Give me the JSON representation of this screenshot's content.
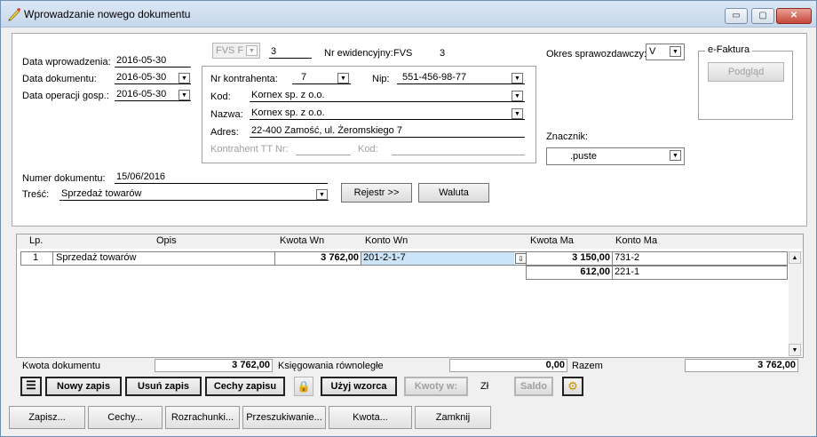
{
  "window": {
    "title": "Wprowadzanie nowego dokumentu",
    "min": "▭",
    "max": "▢",
    "close": "✕"
  },
  "dates": {
    "entry_label": "Data wprowadzenia:",
    "entry_value": "2016-05-30",
    "doc_label": "Data dokumentu:",
    "doc_value": "2016-05-30",
    "op_label": "Data operacji gosp.:",
    "op_value": "2016-05-30"
  },
  "docmeta": {
    "series": "FVS",
    "series_suffix": "F",
    "number": "3",
    "reg_label": "Nr ewidencyjny:",
    "reg_series": "FVS",
    "reg_number": "3"
  },
  "contractor": {
    "nr_label": "Nr kontrahenta:",
    "nr_value": "7",
    "nip_label": "Nip:",
    "nip_value": "551-456-98-77",
    "kod_label": "Kod:",
    "kod_value": "Kornex sp. z o.o.",
    "nazwa_label": "Nazwa:",
    "nazwa_value": "Kornex sp. z o.o.",
    "adres_label": "Adres:",
    "adres_value": "22-400 Zamość, ul. Żeromskiego 7",
    "tt_label": "Kontrahent TT Nr:",
    "tt_kod_label": "Kod:"
  },
  "period": {
    "label": "Okres sprawozdawczy:",
    "value": "V"
  },
  "efaktura": {
    "title": "e-Faktura",
    "button": "Podgląd"
  },
  "marker": {
    "label": "Znacznik:",
    "value": ".puste"
  },
  "doc": {
    "number_label": "Numer dokumentu:",
    "number_value": "15/06/2016",
    "tresc_label": "Treść:",
    "tresc_value": "Sprzedaż towarów",
    "rejestr": "Rejestr >>",
    "waluta": "Waluta"
  },
  "table": {
    "headers": {
      "lp": "Lp.",
      "opis": "Opis",
      "kwota_wn": "Kwota  Wn",
      "konto_wn": "Konto  Wn",
      "kwota_ma": "Kwota Ma",
      "konto_ma": "Konto Ma"
    },
    "rows": [
      {
        "lp": "1",
        "opis": "Sprzedaż towarów",
        "kwota_wn": "3 762,00",
        "konto_wn": "201-2-1-7",
        "kwota_ma": "3 150,00",
        "konto_ma": "731-2"
      },
      {
        "lp": "",
        "opis": "",
        "kwota_wn": "",
        "konto_wn": "",
        "kwota_ma": "612,00",
        "konto_ma": "221-1"
      }
    ]
  },
  "summary": {
    "kwota_label": "Kwota dokumentu",
    "kwota_value": "3 762,00",
    "ksieg_label": "Księgowania równoległe",
    "ksieg_value": "0,00",
    "razem_label": "Razem",
    "razem_value": "3 762,00"
  },
  "actions": {
    "nowy": "Nowy zapis",
    "usun": "Usuń zapis",
    "cechy": "Cechy zapisu",
    "uzyj": "Użyj wzorca",
    "kwoty": "Kwoty w:",
    "currency": "Zł",
    "saldo": "Saldo"
  },
  "bottom": {
    "zapisz": "Zapisz...",
    "cechy": "Cechy...",
    "rozrachunki": "Rozrachunki...",
    "przeszukiwanie": "Przeszukiwanie...",
    "kwota": "Kwota...",
    "zamknij": "Zamknij"
  },
  "colors": {
    "accent_select": "#cce4f7",
    "titlebar": "#c7d8ec"
  }
}
